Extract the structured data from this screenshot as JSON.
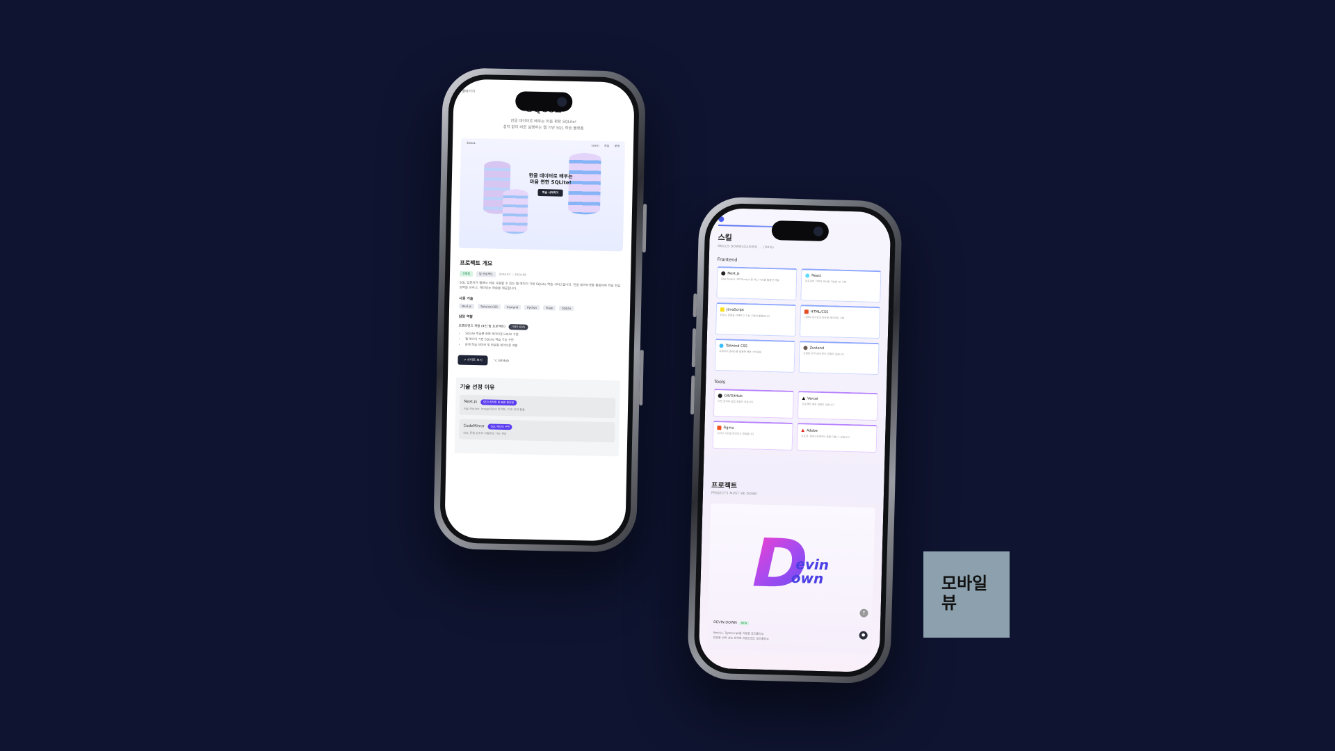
{
  "label": {
    "line1": "모바일",
    "line2": "뷰"
  },
  "phone1": {
    "back": "돌아가기",
    "app_title": "SQooL",
    "subtitle_1": "한글 데이터로 배우는 마음 편한 SQLite!",
    "subtitle_2": "설치 없이 바로 실행하는 웹 기반 SQL 학습 플랫폼",
    "hero": {
      "logo": "SQooL",
      "nav_links": [
        "Learn",
        "연습",
        "문제"
      ],
      "headline_1": "한글 데이터로 배우는",
      "headline_2": "마음 편한 SQLite!",
      "cta": "학습 시작하기"
    },
    "overview": {
      "heading": "프로젝트 개요",
      "tags": [
        "진행중",
        "팀 프로젝트"
      ],
      "period": "2024.07 ~ 2024.09",
      "description": "SQL 입문자가 웹에서 바로 사용할 수 있는 웹 에디터 기반 SQLite 학습 서비스입니다. 한글 데이터셋을 활용하여 학습 진입 장벽을 낮추고, 재미있는 학습을 제공합니다."
    },
    "stack": {
      "heading": "사용 기술",
      "items": [
        "Next.js",
        "Tailwind CSS",
        "Zustand",
        "Python",
        "Flask",
        "SQLite"
      ]
    },
    "role": {
      "heading": "담당 역할",
      "title": "프론트엔드 개발 (4인 팀 프로젝트)",
      "badge": "기여도 60%",
      "items": [
        "SQLite 학습용 화면 레이아웃 UI/UX 구현",
        "웹 에디터 기반 SQLite 학습 기능 구현",
        "문제 학습 데이터 및 반응형 레이아웃 개발"
      ]
    },
    "buttons": {
      "site": "사이트 보기",
      "github": "GitHub"
    },
    "tech_reason": {
      "heading": "기술 선정 이유",
      "items": [
        {
          "name": "Next.js",
          "badge": "SEO 최적화 및 빠른 렌더링",
          "desc": "App Router, Image/Font 최적화, CSR 전략 활용"
        },
        {
          "name": "CodeMirror",
          "badge": "SQL 에디터 구현",
          "desc": "SQL 문법 강조와 자동완성 기능 제공"
        }
      ]
    }
  },
  "phone2": {
    "heading": "스킬",
    "subtitle": "SKILLS DOWNLOADING ... (99%)",
    "frontend_label": "Frontend",
    "frontend": [
      {
        "icon": "nextjs-icon",
        "color": "#222222",
        "name": "Next.js",
        "desc": "App Router, API Routes 등 최신 기능을 활용한 개발"
      },
      {
        "icon": "react-icon",
        "color": "#61dafb",
        "name": "React",
        "desc": "컴포넌트 기반의 재사용 가능한 UI 구현"
      },
      {
        "icon": "javascript-icon",
        "color": "#f7df1e",
        "name": "JavaScript",
        "desc": "ES6+ 문법을 이해하고 기능 구현에 활용합니다"
      },
      {
        "icon": "htmlcss-icon",
        "color": "#e44d26",
        "name": "HTML/CSS",
        "desc": "시맨틱 마크업과 반응형 레이아웃 구현"
      },
      {
        "icon": "tailwind-icon",
        "color": "#38bdf8",
        "name": "Tailwind CSS",
        "desc": "유틸리티 클래스를 활용한 빠른 스타일링"
      },
      {
        "icon": "zustand-icon",
        "color": "#6b5a4e",
        "name": "Zustand",
        "desc": "간결한 전역 상태 관리 경험이 있습니다"
      }
    ],
    "tools_label": "Tools",
    "tools": [
      {
        "icon": "github-icon",
        "color": "#222222",
        "name": "Git/GitHub",
        "desc": "버전 관리와 협업 경험이 있습니다"
      },
      {
        "icon": "vercel-icon",
        "color": "#111111",
        "name": "Vercel",
        "desc": "프로젝트 배포 경험이 있습니다"
      },
      {
        "icon": "figma-icon",
        "color": "#f24e1e",
        "name": "Figma",
        "desc": "디자인 시안을 확인하고 협업합니다"
      },
      {
        "icon": "adobe-icon",
        "color": "#e1251b",
        "name": "Adobe",
        "desc": "포토샵, 일러스트레이터 등을 다룰 수 있습니다"
      }
    ],
    "projects_heading": "프로젝트",
    "projects_subtitle": "PROJECTS MUST BE DONE!",
    "project": {
      "logo_d": "D",
      "logo_evin": "evin",
      "logo_own": "own",
      "name": "DEVIN DOWN",
      "badge": "NEW",
      "desc_1": "Next.js, TypeScript를 이용한 포트폴리오",
      "desc_2": "반응형 UI와 성능 최적화 프론트엔드 포트폴리오"
    }
  }
}
